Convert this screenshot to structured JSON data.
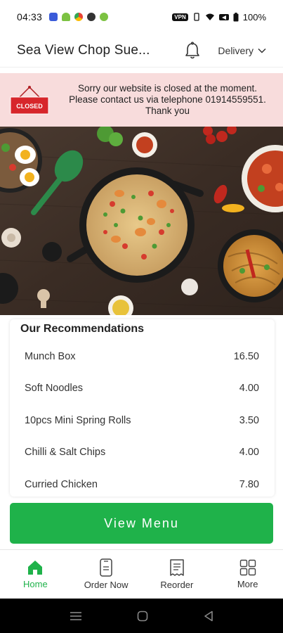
{
  "status_bar": {
    "time": "04:33",
    "battery": "100%",
    "vpn": "VPN"
  },
  "header": {
    "title": "Sea View Chop Sue...",
    "delivery_label": "Delivery"
  },
  "banner": {
    "sign_text": "CLOSED",
    "line1": "Sorry our website is closed at the moment.",
    "line2": "Please contact us via telephone 01914559551.",
    "line3": "Thank you"
  },
  "recommendations": {
    "title": "Our Recommendations",
    "items": [
      {
        "name": "Munch Box",
        "price": "16.50"
      },
      {
        "name": "Soft Noodles",
        "price": "4.00"
      },
      {
        "name": "10pcs Mini Spring Rolls",
        "price": "3.50"
      },
      {
        "name": "Chilli & Salt Chips",
        "price": "4.00"
      },
      {
        "name": "Curried Chicken",
        "price": "7.80"
      }
    ]
  },
  "view_menu_label": "View Menu",
  "bottom_nav": {
    "items": [
      {
        "label": "Home",
        "icon": "home-icon",
        "active": true
      },
      {
        "label": "Order Now",
        "icon": "phone-icon",
        "active": false
      },
      {
        "label": "Reorder",
        "icon": "receipt-icon",
        "active": false
      },
      {
        "label": "More",
        "icon": "grid-icon",
        "active": false
      }
    ]
  },
  "colors": {
    "accent": "#1fb24a",
    "banner_bg": "#f8dcdc",
    "closed_sign": "#d7262b"
  }
}
